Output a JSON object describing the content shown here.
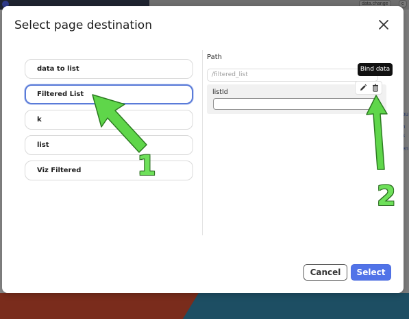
{
  "background": {
    "chips": [
      "data.change",
      "c"
    ],
    "side_texts": [
      "ou",
      "h",
      "s",
      "en"
    ]
  },
  "modal": {
    "title": "Select page destination",
    "close_icon": "close-icon"
  },
  "destinations": [
    {
      "label": "data to list",
      "selected": false
    },
    {
      "label": "Filtered List",
      "selected": true
    },
    {
      "label": "k",
      "selected": false
    },
    {
      "label": "list",
      "selected": false
    },
    {
      "label": "Viz Filtered",
      "selected": false
    }
  ],
  "path": {
    "label": "Path",
    "placeholder": "/filtered_list"
  },
  "param": {
    "label": "listId",
    "value": ""
  },
  "tooltip": "Bind data",
  "icons": {
    "edit": "pencil-icon",
    "delete": "trash-icon"
  },
  "annotations": [
    "1",
    "2"
  ],
  "buttons": {
    "cancel": "Cancel",
    "select": "Select"
  },
  "colors": {
    "accent": "#5173e8",
    "selected_border": "#5a7bd8",
    "annotation": "#6ee05a"
  }
}
